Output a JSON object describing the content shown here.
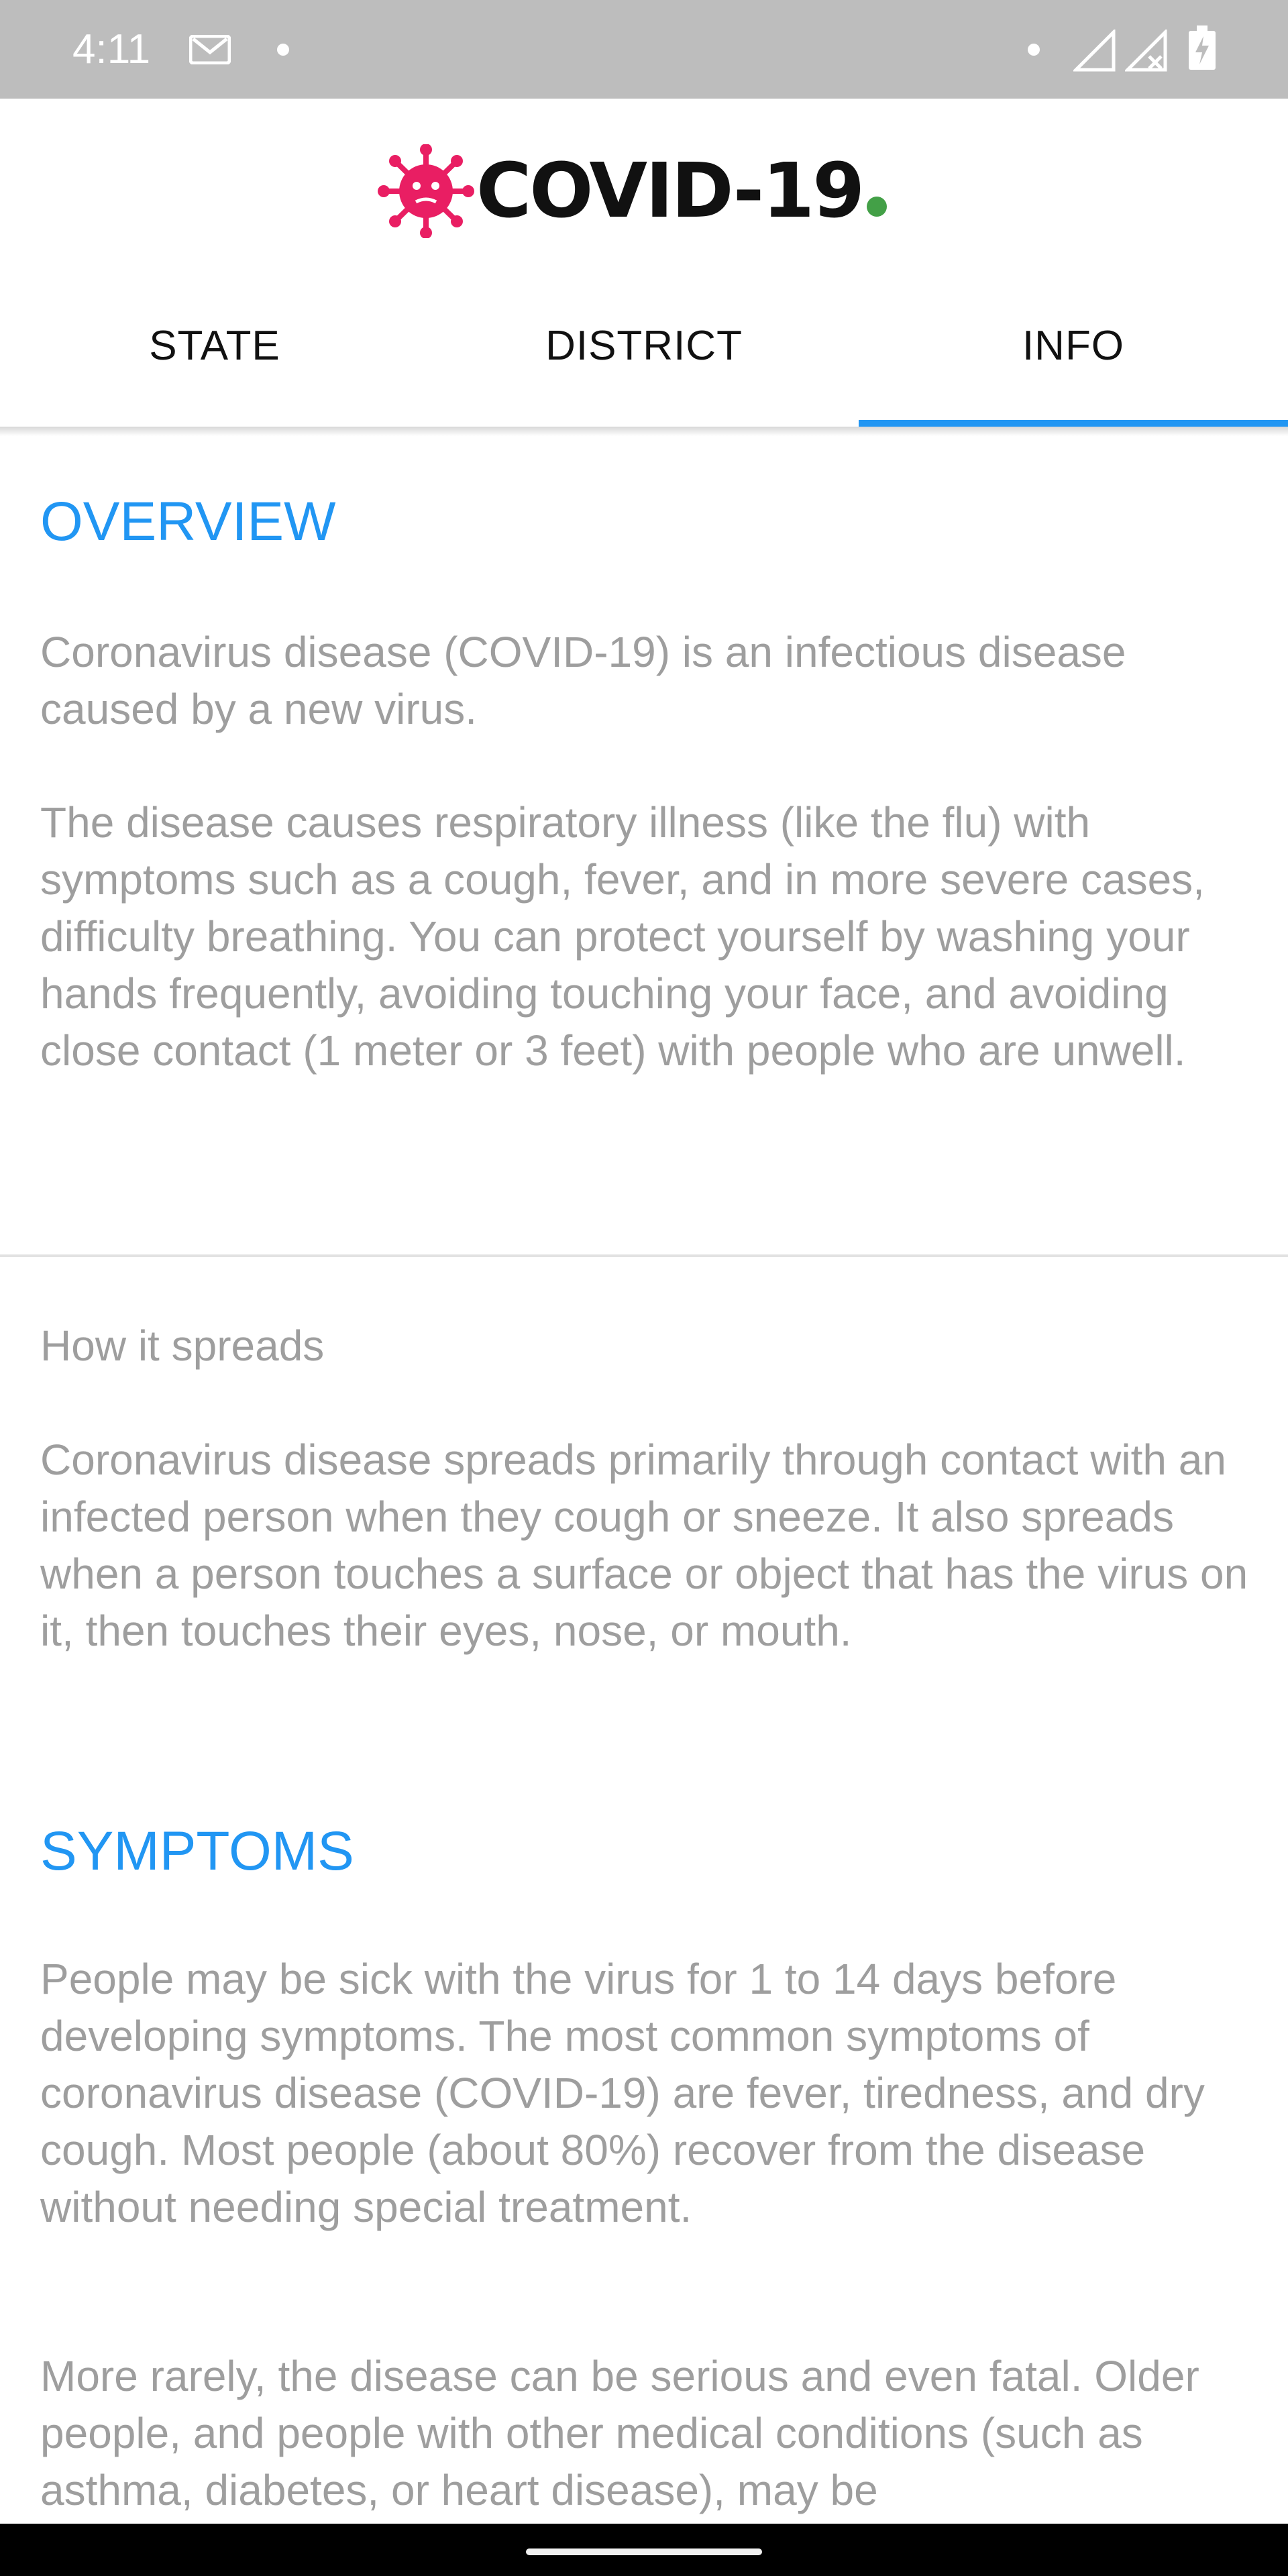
{
  "status_bar": {
    "time": "4:11",
    "icons": [
      "mail-icon",
      "notification-dot-icon",
      "signal-icon",
      "no-signal-icon",
      "battery-charging-icon"
    ]
  },
  "header": {
    "logo_text": "COVID-19",
    "logo_icon": "virus-icon",
    "logo_dot_color": "#43a047",
    "virus_color": "#e91e63"
  },
  "tabs": [
    {
      "label": "STATE",
      "active": false
    },
    {
      "label": "DISTRICT",
      "active": false
    },
    {
      "label": "INFO",
      "active": true
    }
  ],
  "accent_color": "#2196f3",
  "overview": {
    "title": "OVERVIEW",
    "p1": "Coronavirus disease (COVID-19) is an infectious disease caused by a new virus.",
    "p2": "The disease causes respiratory illness (like the flu) with symptoms such as a cough, fever, and in more severe cases, difficulty breathing. You can protect yourself by washing your hands frequently, avoiding touching your face, and avoiding close contact (1 meter or 3 feet) with people who are unwell."
  },
  "spread": {
    "heading": "How it spreads",
    "p1": "Coronavirus disease spreads primarily through contact with an infected person when they cough or sneeze. It also spreads when a person touches a surface or object that has the virus on it, then touches their eyes, nose, or mouth."
  },
  "symptoms": {
    "title": "SYMPTOMS",
    "p1": "People may be sick with the virus for 1 to 14 days before developing symptoms. The most common symptoms of coronavirus disease (COVID-19) are fever, tiredness, and dry cough. Most people (about 80%) recover from the disease without needing special treatment.",
    "p2": "More rarely, the disease can be serious and even fatal. Older people, and people with other medical conditions (such as asthma, diabetes, or heart disease), may be"
  }
}
